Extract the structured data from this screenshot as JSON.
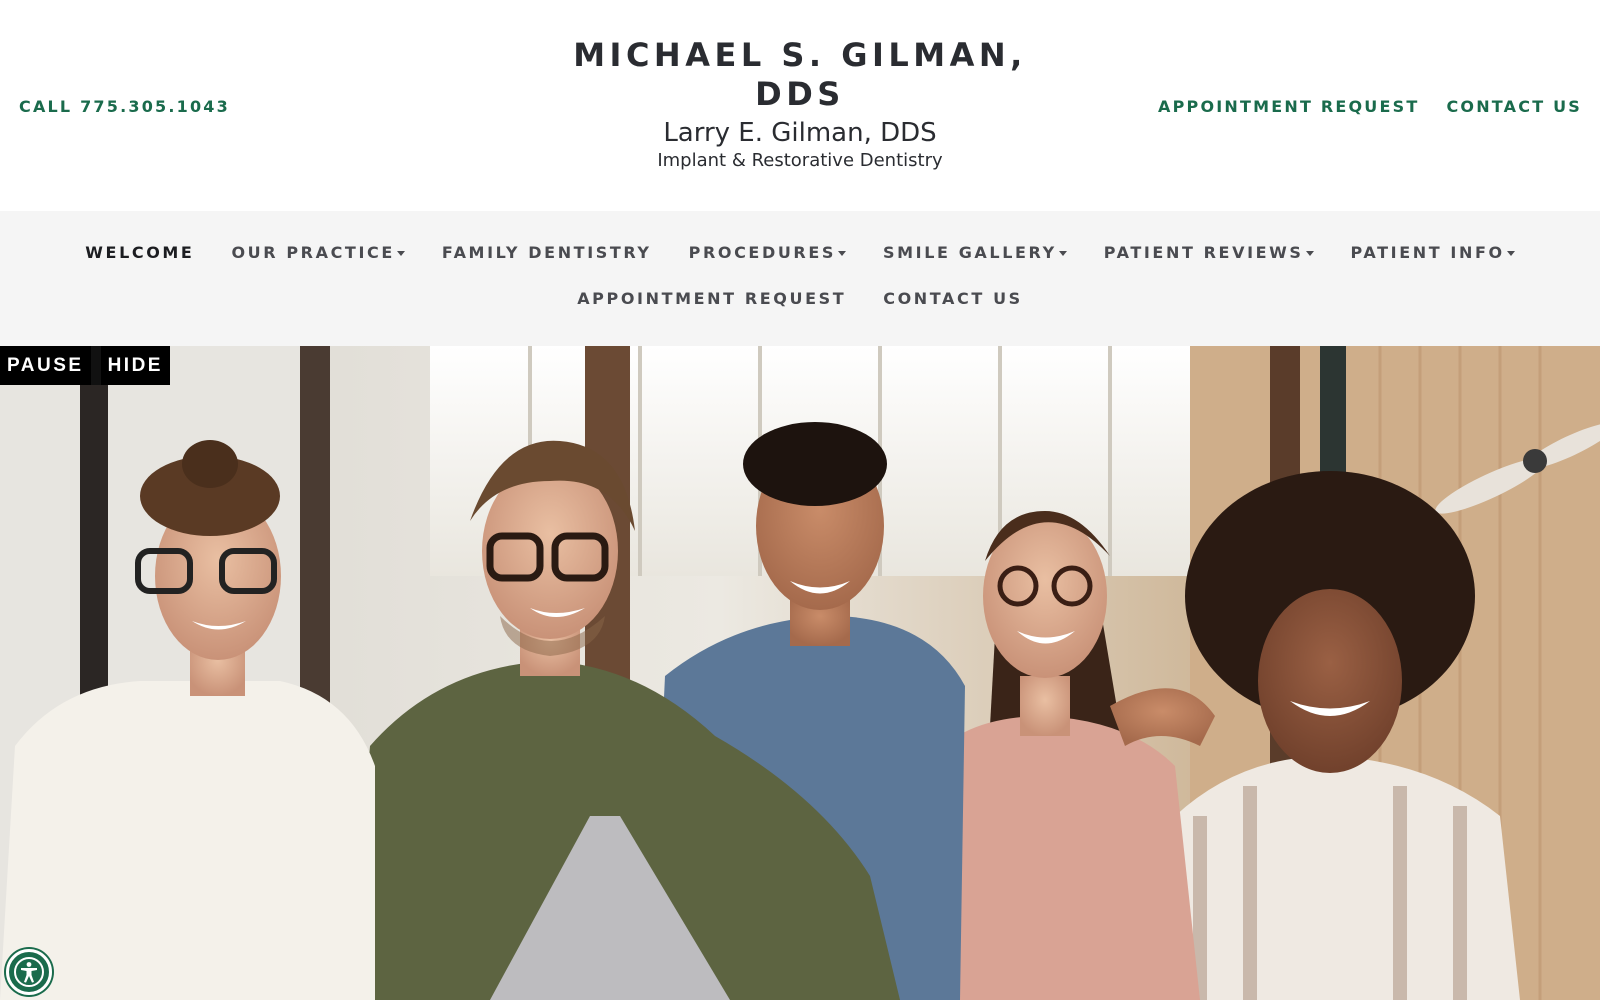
{
  "header": {
    "call": "CALL 775.305.1043",
    "title": "MICHAEL S. GILMAN, DDS",
    "subtitle": "Larry E. Gilman, DDS",
    "tagline": "Implant & Restorative Dentistry",
    "links": [
      "APPOINTMENT REQUEST",
      "CONTACT US"
    ]
  },
  "nav": {
    "row1": [
      {
        "label": "WELCOME",
        "dropdown": false,
        "active": true
      },
      {
        "label": "OUR PRACTICE",
        "dropdown": true
      },
      {
        "label": "FAMILY DENTISTRY",
        "dropdown": false
      },
      {
        "label": "PROCEDURES",
        "dropdown": true
      },
      {
        "label": "SMILE GALLERY",
        "dropdown": true
      },
      {
        "label": "PATIENT REVIEWS",
        "dropdown": true
      },
      {
        "label": "PATIENT INFO",
        "dropdown": true
      }
    ],
    "row2": [
      {
        "label": "APPOINTMENT REQUEST",
        "dropdown": false
      },
      {
        "label": "CONTACT US",
        "dropdown": false
      }
    ]
  },
  "slider": {
    "pause": "PAUSE",
    "hide": "HIDE"
  },
  "icons": {
    "dropdown": "chevron-down-icon",
    "accessibility": "accessibility-icon"
  },
  "colors": {
    "brand_green": "#1a6b4c",
    "nav_bg": "#f5f5f5",
    "text_dark": "#2a2c31"
  }
}
